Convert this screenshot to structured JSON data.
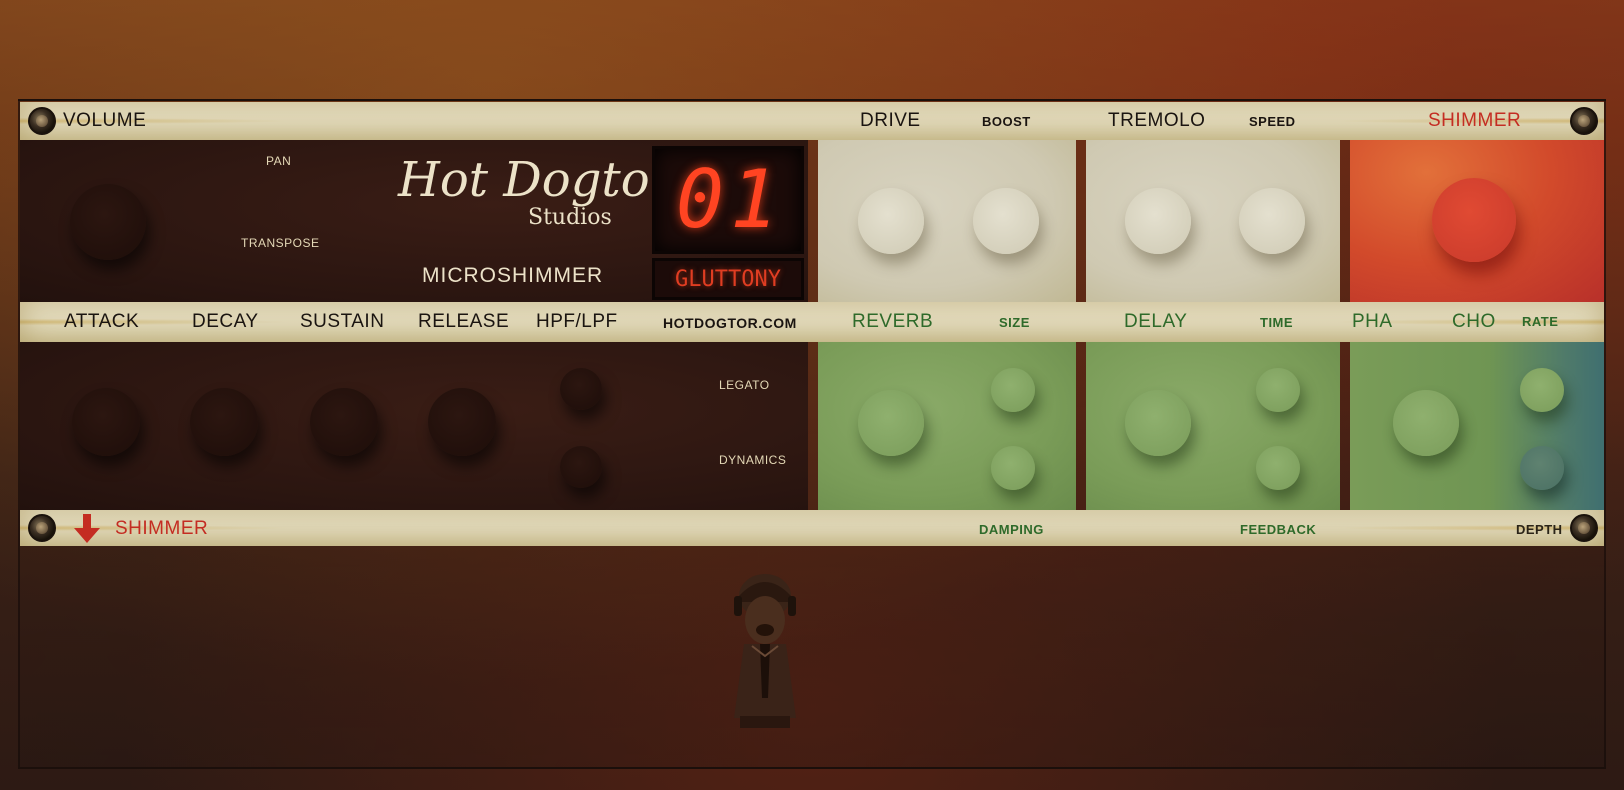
{
  "brand": {
    "name": "Hot Dogtor",
    "sub": "Studios",
    "product": "MICROSHIMMER",
    "website": "HOTDOGTOR.COM"
  },
  "display": {
    "preset_number": "01",
    "preset_name": "GLUTTONY"
  },
  "top_band": {
    "volume": "VOLUME",
    "drive": "DRIVE",
    "boost": "BOOST",
    "tremolo": "TREMOLO",
    "speed": "SPEED",
    "shimmer": "SHIMMER"
  },
  "upper_panel": {
    "pan": "PAN",
    "transpose": "TRANSPOSE"
  },
  "mid_band": {
    "attack": "ATTACK",
    "decay": "DECAY",
    "sustain": "SUSTAIN",
    "release": "RELEASE",
    "filter": "HPF/LPF",
    "reverb": "REVERB",
    "size": "SIZE",
    "delay": "DELAY",
    "time": "TIME",
    "pha": "PHA",
    "cho": "CHO",
    "rate": "RATE"
  },
  "lower_panel": {
    "legato": "LEGATO",
    "dynamics": "DYNAMICS"
  },
  "bottom_band": {
    "shimmer": "SHIMMER",
    "damping": "DAMPING",
    "feedback": "FEEDBACK",
    "depth": "DEPTH"
  },
  "colors": {
    "accent_red": "#c42c22",
    "accent_green": "#2e6a2a",
    "led": "#ff4422"
  },
  "icons": {
    "collapse": "arrow-down-icon",
    "mascot": "dog-mascot-icon",
    "screw": "screw-icon"
  }
}
